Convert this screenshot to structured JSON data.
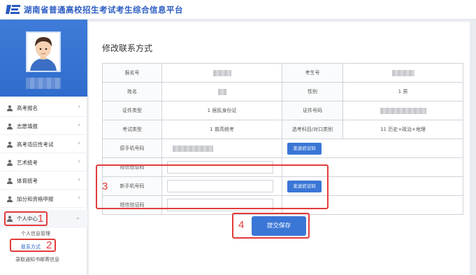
{
  "header": {
    "title": "湖南省普通高校招生考试考生综合信息平台"
  },
  "sidebar": {
    "menu": [
      {
        "label": "高考报名",
        "arrow": "‹"
      },
      {
        "label": "志愿填报",
        "arrow": "‹"
      },
      {
        "label": "高考适应性考试",
        "arrow": "‹"
      },
      {
        "label": "艺术统考",
        "arrow": "‹"
      },
      {
        "label": "体育统考",
        "arrow": "‹"
      },
      {
        "label": "加分和资格申报",
        "arrow": "‹"
      },
      {
        "label": "个人中心",
        "arrow": "⌄"
      }
    ],
    "submenu": [
      {
        "label": "个人信息管理"
      },
      {
        "label": "联系方式"
      },
      {
        "label": "录取通知书邮寄信息"
      }
    ]
  },
  "annotations": {
    "n1": "1",
    "n2": "2",
    "n3": "3",
    "n4": "4"
  },
  "main": {
    "title": "修改联系方式",
    "rows": {
      "exam_no_label": "报名号",
      "candidate_no_label": "考生号",
      "name_label": "姓名",
      "gender_label": "性别",
      "gender_value": "1 男",
      "id_type_label": "证件类型",
      "id_type_value": "1 居民身份证",
      "id_no_label": "证件号码",
      "exam_type_label": "考试类型",
      "exam_type_value": "1 普高统考",
      "subjects_label": "选考科目/对口类别",
      "subjects_value": "11 历史+政治+地理",
      "old_phone_label": "原手机号码",
      "sms_code_label": "短信验证码",
      "new_phone_label": "新手机号码",
      "new_sms_code_label": "短信验证码",
      "send_code_label": "发送验证码"
    },
    "submit_label": "提交保存"
  }
}
